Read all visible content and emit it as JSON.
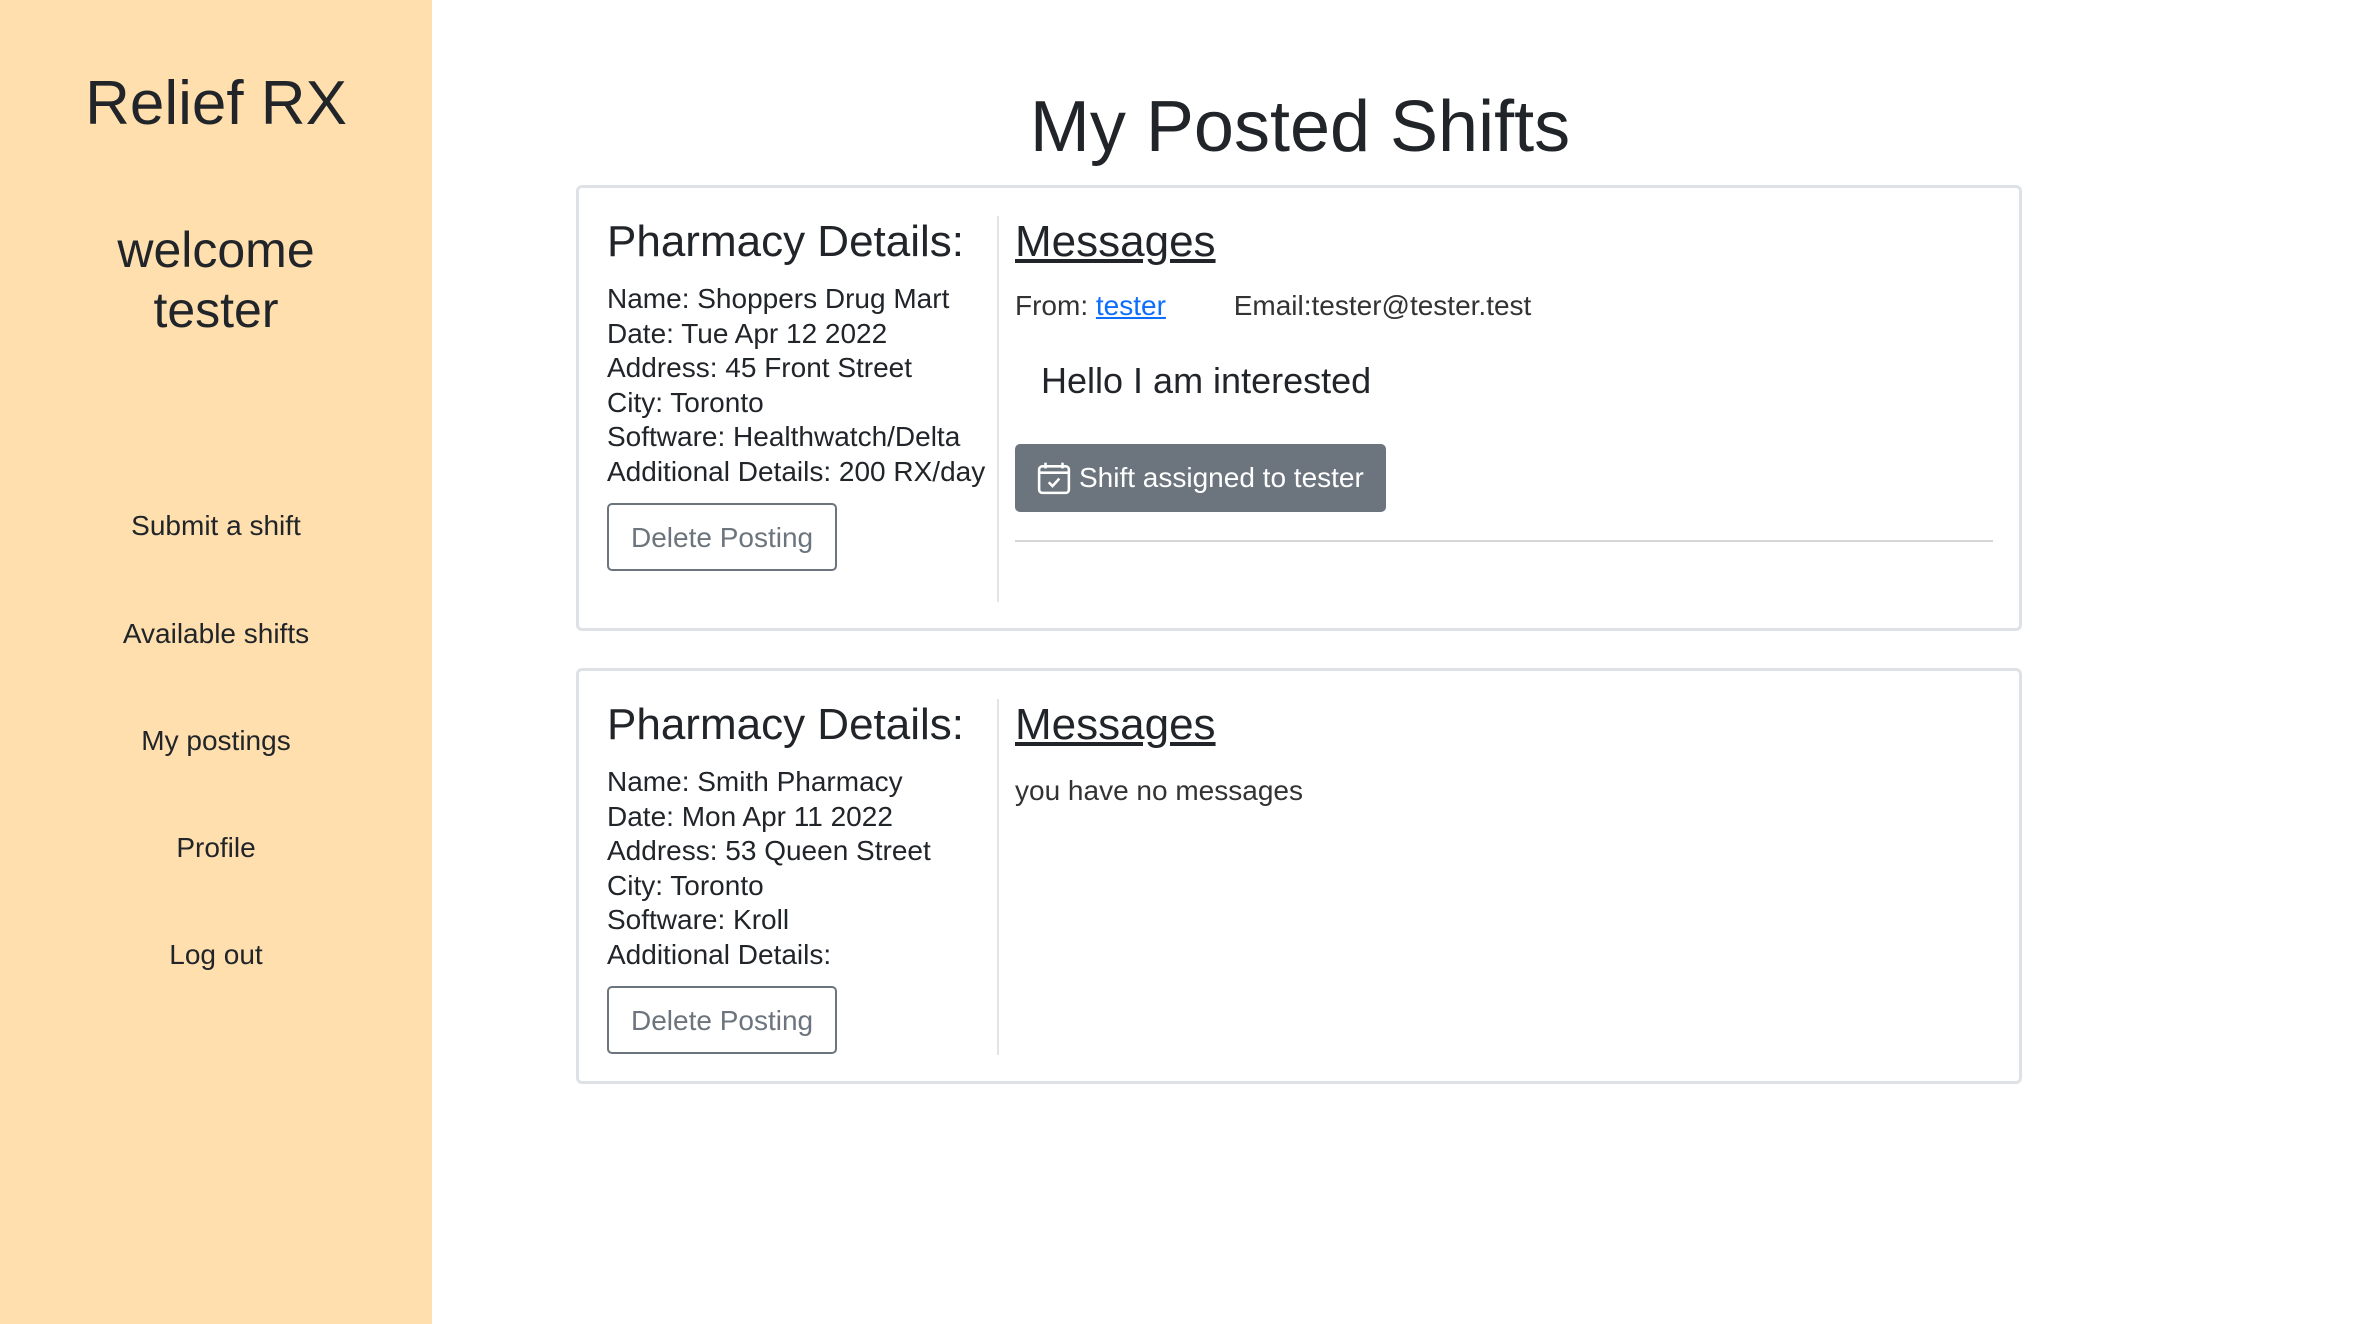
{
  "sidebar": {
    "brand": "Relief RX",
    "welcome_line1": "welcome",
    "welcome_line2": "tester",
    "nav": [
      "Submit a shift",
      "Available shifts",
      "My postings",
      "Profile",
      "Log out"
    ],
    "background": "#ffdfad"
  },
  "main": {
    "title": "My Posted Shifts"
  },
  "postings": [
    {
      "details_heading": "Pharmacy Details:",
      "name": "Name: Shoppers Drug Mart",
      "date": "Date: Tue Apr 12 2022",
      "address": "Address: 45 Front Street",
      "city": "City: Toronto",
      "software": "Software: Healthwatch/Delta",
      "additional": "Additional Details: 200 RX/day",
      "delete_label": "Delete Posting",
      "messages_heading": "Messages",
      "message": {
        "from_label": "From:",
        "from_user": "tester",
        "email": "Email:tester@tester.test",
        "body": "Hello I am interested",
        "assigned_label": "Shift assigned to tester",
        "assigned_icon": "calendar-check-icon"
      }
    },
    {
      "details_heading": "Pharmacy Details:",
      "name": "Name: Smith Pharmacy",
      "date": "Date: Mon Apr 11 2022",
      "address": "Address: 53 Queen Street",
      "city": "City: Toronto",
      "software": "Software: Kroll",
      "additional": "Additional Details:",
      "delete_label": "Delete Posting",
      "messages_heading": "Messages",
      "no_messages": "you have no messages"
    }
  ]
}
